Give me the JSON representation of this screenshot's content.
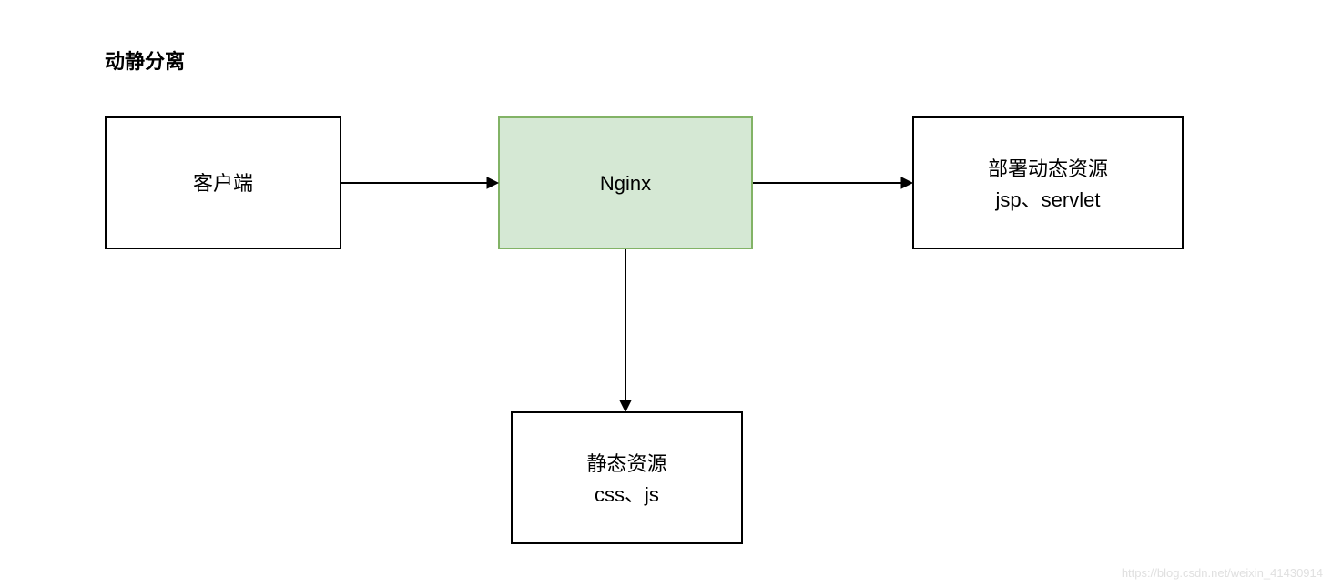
{
  "title": "动静分离",
  "nodes": {
    "client": {
      "label": "客户端"
    },
    "nginx": {
      "label": "Nginx"
    },
    "dynamic": {
      "label": "部署动态资源",
      "sublabel": "jsp、servlet"
    },
    "static": {
      "label": "静态资源",
      "sublabel": "css、js"
    }
  },
  "watermark": "https://blog.csdn.net/weixin_41430914"
}
